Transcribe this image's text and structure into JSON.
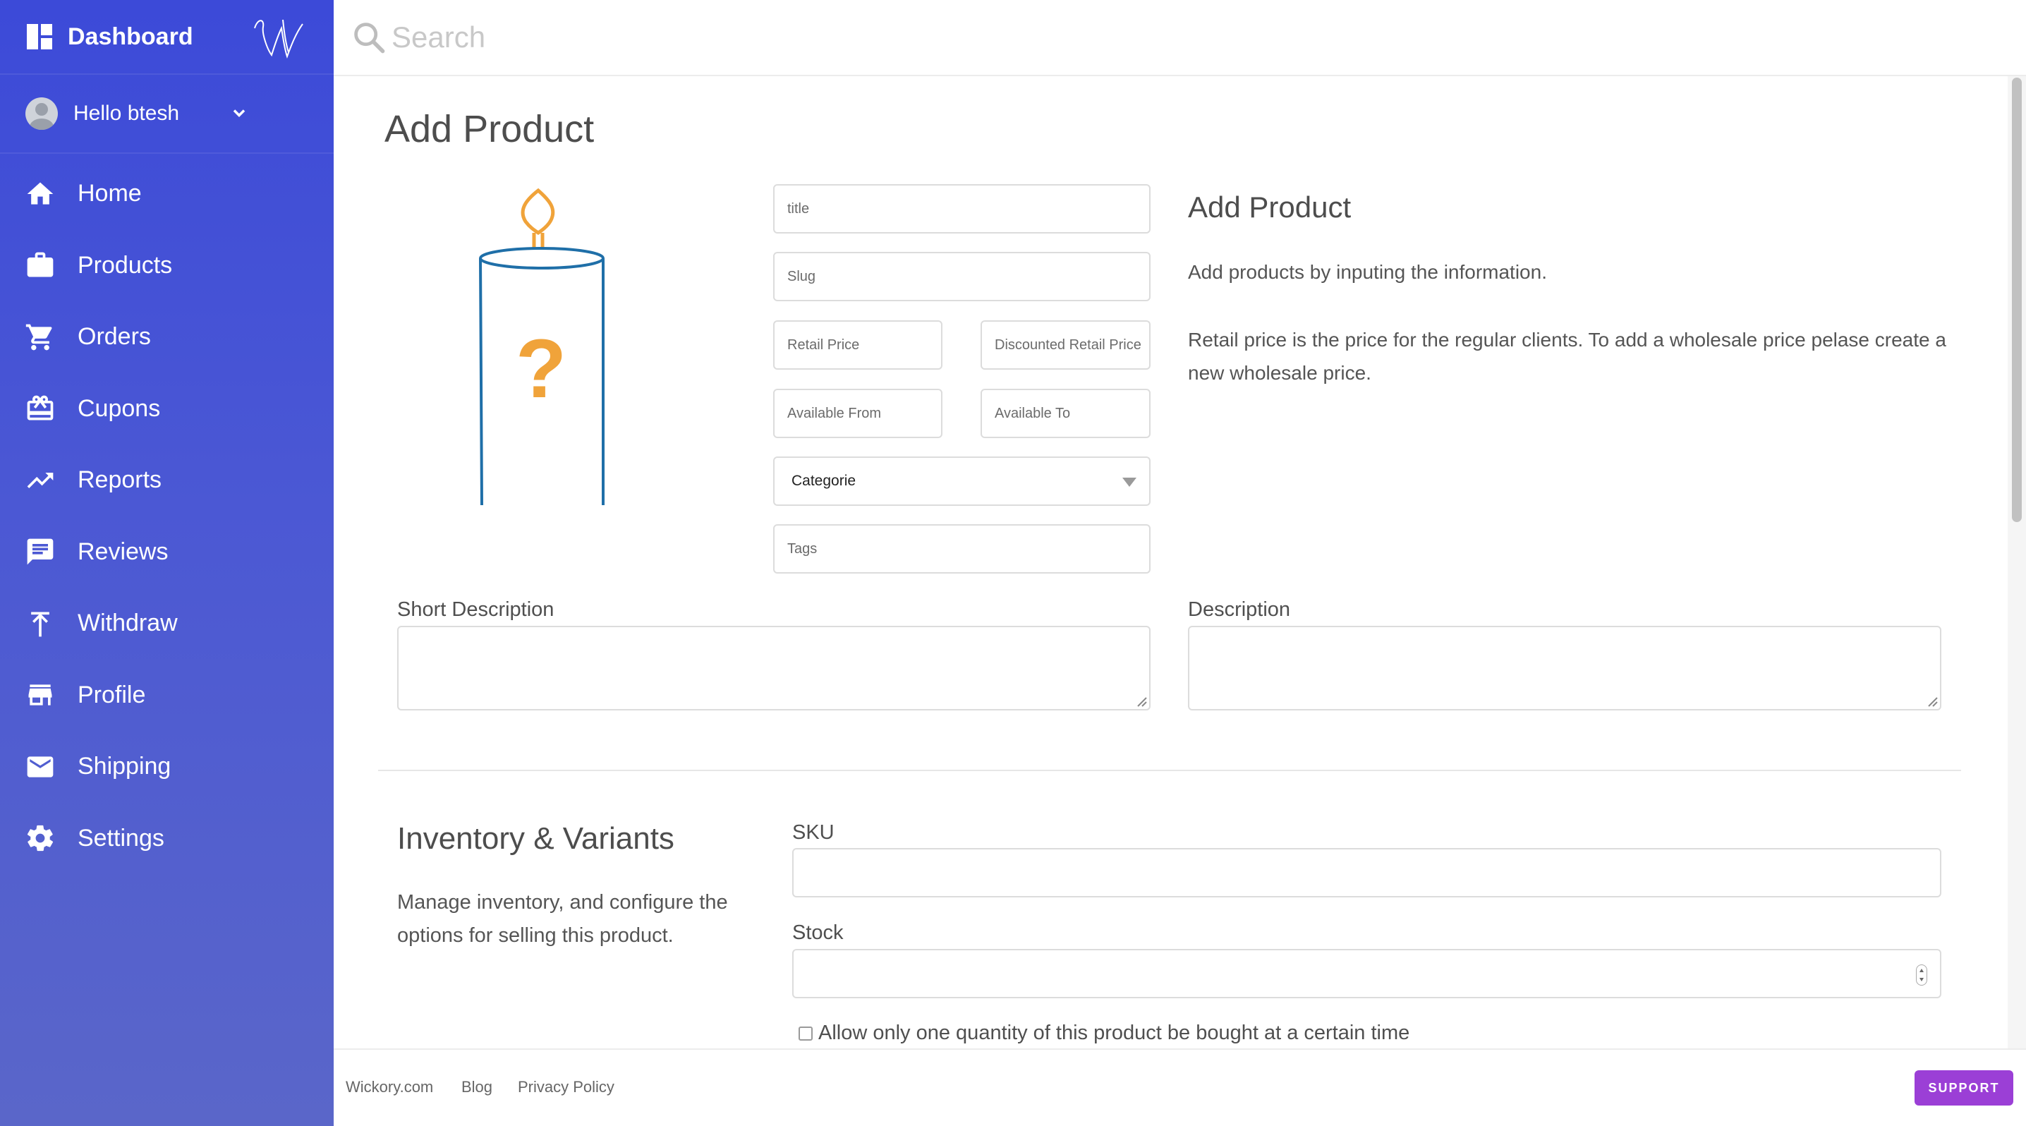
{
  "sidebar": {
    "title": "Dashboard",
    "user_greeting": "Hello btesh",
    "items": [
      {
        "label": "Home",
        "icon": "home-icon"
      },
      {
        "label": "Products",
        "icon": "briefcase-icon"
      },
      {
        "label": "Orders",
        "icon": "cart-icon"
      },
      {
        "label": "Cupons",
        "icon": "gift-card-icon"
      },
      {
        "label": "Reports",
        "icon": "trending-up-icon"
      },
      {
        "label": "Reviews",
        "icon": "comment-icon"
      },
      {
        "label": "Withdraw",
        "icon": "upload-arrow-icon"
      },
      {
        "label": "Profile",
        "icon": "store-icon"
      },
      {
        "label": "Shipping",
        "icon": "mail-icon"
      },
      {
        "label": "Settings",
        "icon": "gear-icon"
      }
    ]
  },
  "search": {
    "placeholder": "Search"
  },
  "page": {
    "title": "Add Product"
  },
  "form": {
    "title_placeholder": "title",
    "slug_placeholder": "Slug",
    "retail_price_placeholder": "Retail Price",
    "discounted_price_placeholder": "Discounted Retail Price",
    "available_from_placeholder": "Available From",
    "available_to_placeholder": "Available To",
    "category_selected": "Categorie",
    "tags_placeholder": "Tags",
    "short_description_label": "Short Description",
    "description_label": "Description"
  },
  "info": {
    "title": "Add Product",
    "paragraph1": "Add products by inputing the information.",
    "paragraph2": "Retail price is the price for the regular clients. To add a wholesale price pelase create a new wholesale price."
  },
  "inventory": {
    "title": "Inventory & Variants",
    "description": "Manage inventory, and configure the options for selling this product.",
    "sku_label": "SKU",
    "stock_label": "Stock",
    "single_quantity_label": "Allow only one quantity of this product be bought at a certain time"
  },
  "footer": {
    "links": [
      "Wickory.com",
      "Blog",
      "Privacy Policy"
    ],
    "support_label": "SUPPORT"
  },
  "colors": {
    "sidebar_top": "#3c4ad8",
    "sidebar_bottom": "#5a66c9",
    "support_button": "#9b3fd6",
    "candle_outline": "#1f6fa8",
    "candle_flame": "#f0a33a"
  }
}
